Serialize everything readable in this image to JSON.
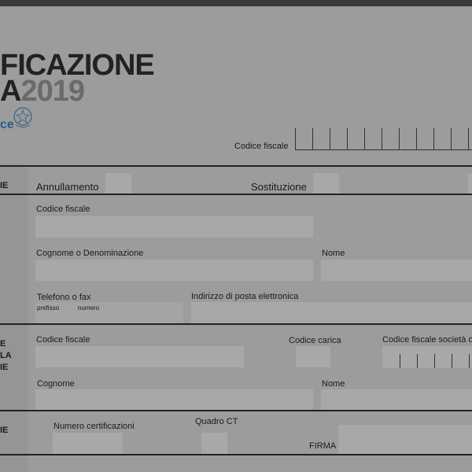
{
  "header": {
    "title_line1": "FICAZIONE",
    "title_line2_prefix": "A",
    "title_line2_year": "2019",
    "agency_text": "ce",
    "emblem_icon": "republic-emblem-icon"
  },
  "codice_fiscale_header": {
    "label": "Codice fiscale"
  },
  "row_type": {
    "side_label": "IE",
    "annullamento": "Annullamento",
    "sostituzione": "Sostituzione"
  },
  "contribuente": {
    "codice_fiscale": "Codice fiscale",
    "cognome": "Cognome o Denominazione",
    "nome": "Nome",
    "telefono": "Telefono o fax",
    "prefisso": "prefisso",
    "numero": "numero",
    "email": "Indirizzo di posta elettronica"
  },
  "firmatario": {
    "side_label": "E\nLA\nIE",
    "codice_fiscale": "Codice fiscale",
    "codice_carica": "Codice carica",
    "cf_societa": "Codice fiscale società o ente",
    "cognome": "Cognome",
    "nome": "Nome"
  },
  "firma_section": {
    "side_label": "IE",
    "numero_certificazioni": "Numero certificazioni",
    "quadro_ct": "Quadro CT",
    "firma": "FIRMA"
  }
}
